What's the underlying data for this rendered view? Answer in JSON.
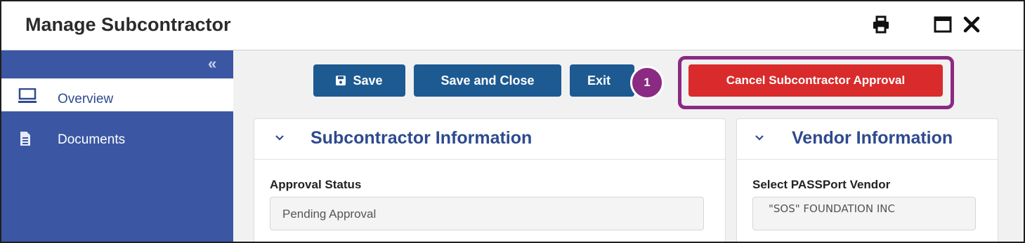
{
  "window": {
    "title": "Manage Subcontractor",
    "icons": [
      "print-icon",
      "maximize-icon",
      "close-icon"
    ]
  },
  "sidebar": {
    "collapse_glyph": "«",
    "items": [
      {
        "label": "Overview",
        "icon": "monitor-icon",
        "active": true
      },
      {
        "label": "Documents",
        "icon": "document-icon",
        "active": false
      }
    ]
  },
  "toolbar": {
    "save_label": "Save",
    "save_close_label": "Save and Close",
    "exit_label": "Exit",
    "cancel_label": "Cancel Subcontractor Approval",
    "step_number": "1"
  },
  "panels": {
    "subcontractor": {
      "title": "Subcontractor Information",
      "field_label": "Approval Status",
      "field_value": "Pending Approval"
    },
    "vendor": {
      "title": "Vendor Information",
      "field_label": "Select PASSPort Vendor",
      "field_value": "\"SOS\" FOUNDATION INC"
    }
  },
  "colors": {
    "sidebar_bg": "#3b57a3",
    "primary_button": "#1d5a92",
    "danger_button": "#d92b2b",
    "highlight": "#8b2a82",
    "heading_blue": "#2e4a8f"
  }
}
